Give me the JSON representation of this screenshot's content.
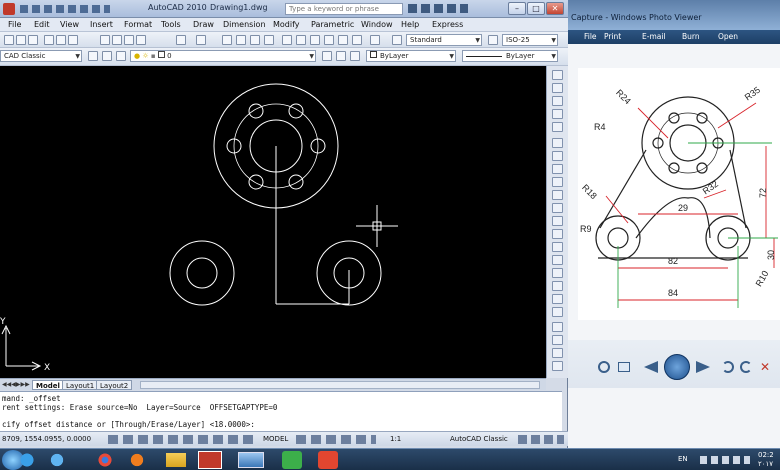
{
  "acad": {
    "title": "AutoCAD 2010",
    "drawing": "Drawing1.dwg",
    "search_placeholder": "Type a keyword or phrase",
    "menu": [
      "File",
      "Edit",
      "View",
      "Insert",
      "Format",
      "Tools",
      "Draw",
      "Dimension",
      "Modify",
      "Parametric",
      "Window",
      "Help",
      "Express"
    ],
    "workspace": "CAD Classic",
    "layer_value": "0",
    "text_style": "Standard",
    "dim_style": "ISO-25",
    "color": "ByLayer",
    "linetype": "ByLayer",
    "tabs": [
      "Model",
      "Layout1",
      "Layout2"
    ],
    "active_tab": "Model",
    "cmd_lines": [
      "mand: _offset",
      "rent settings: Erase source=No  Layer=Source  OFFSETGAPTYPE=0",
      "",
      "cify offset distance or [Through/Erase/Layer] <18.0000>:"
    ],
    "coords": "8709, 1554.0955, 0.0000",
    "model_btn": "MODEL",
    "scale": "1:1",
    "status_workspace": "AutoCAD Classic",
    "ucs_y": "Y",
    "ucs_x": "X"
  },
  "viewer": {
    "title": "Capture - Windows Photo Viewer",
    "menu": [
      "File",
      "Print",
      "E-mail",
      "Burn",
      "Open"
    ],
    "dims": [
      "R24",
      "R35",
      "R4",
      "R18",
      "R32",
      "R9",
      "29",
      "72",
      "82",
      "84",
      "30",
      "R10"
    ]
  },
  "taskbar": {
    "lang": "EN",
    "time": "02:2",
    "date": "۲۰۱۷"
  },
  "colors": {
    "canvas": "#000000",
    "drawing": "#ffffff",
    "dim_red": "#d8232a",
    "dim_green": "#2fa84a"
  }
}
